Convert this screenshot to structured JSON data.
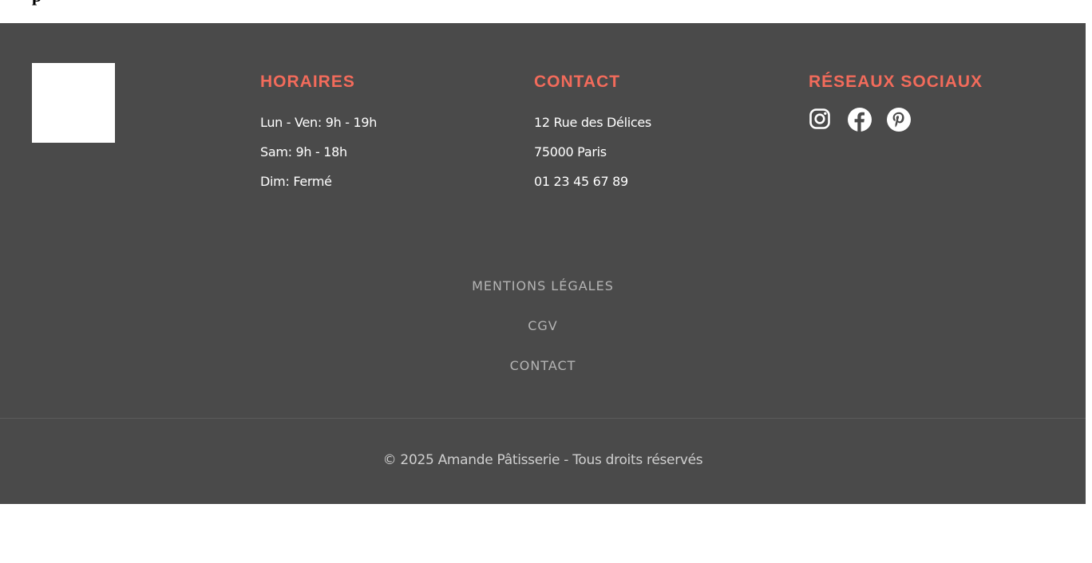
{
  "top_partial_text": "p",
  "footer": {
    "background": "#4a4a4a",
    "accent": "#f26b5b",
    "horaires": {
      "title": "HORAIRES",
      "lines": [
        "Lun - Ven: 9h - 19h",
        "Sam: 9h - 18h",
        "Dim: Fermé"
      ]
    },
    "contact": {
      "title": "CONTACT",
      "lines": [
        "12 Rue des Délices",
        "75000 Paris",
        "01 23 45 67 89"
      ]
    },
    "social": {
      "title": "RÉSEAUX SOCIAUX",
      "icons": [
        "instagram-icon",
        "facebook-icon",
        "pinterest-icon"
      ]
    },
    "legal_links": [
      "MENTIONS LÉGALES",
      "CGV",
      "CONTACT"
    ],
    "copyright": "© 2025 Amande Pâtisserie - Tous droits réservés"
  }
}
